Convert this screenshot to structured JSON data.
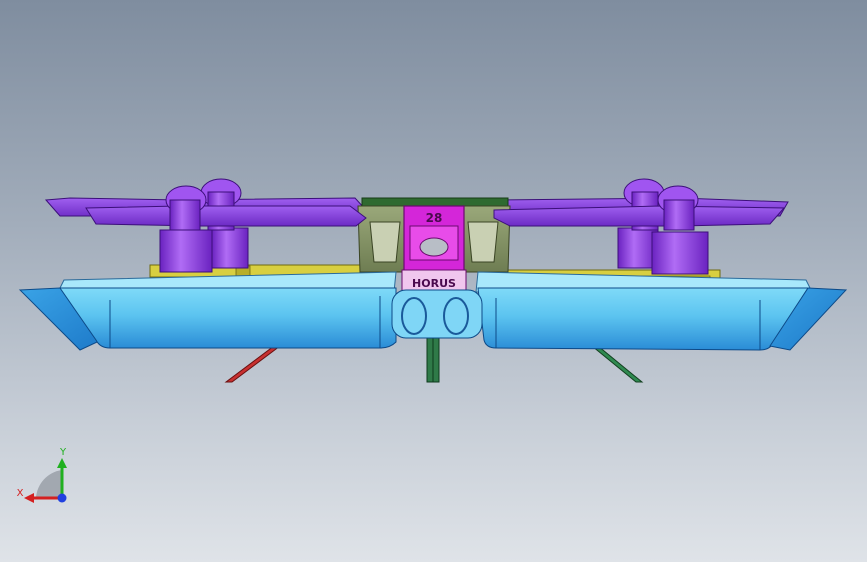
{
  "model": {
    "frame_number": "28",
    "brand_label": "HORUS"
  },
  "triad": {
    "x_label": "X",
    "y_label": "Y"
  },
  "colors": {
    "background_top": "#7f8d9f",
    "background_bottom": "#dfe3e8",
    "pontoon": "#5fc6f2",
    "pontoon_dark": "#2b8fd8",
    "propeller": "#8d3fe0",
    "motor": "#9a4bea",
    "frame_center": "#d426d9",
    "frame_bracket": "#8c9a6a",
    "arm_yellow": "#d8cf40",
    "leg_red": "#c83030",
    "leg_green": "#2f8a50",
    "axis_x": "#d42020",
    "axis_y": "#20b020",
    "axis_z": "#2040e0"
  }
}
